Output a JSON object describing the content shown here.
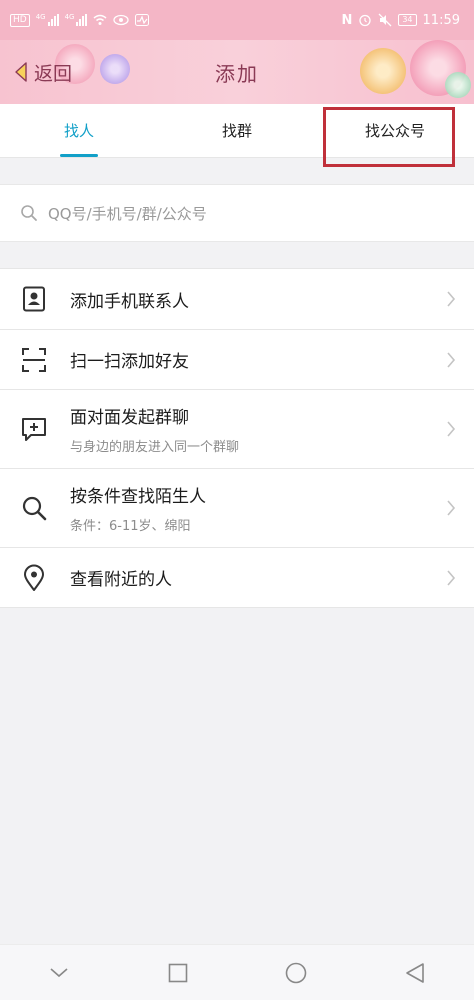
{
  "status_bar": {
    "hd_label": "HD",
    "net1": "4G",
    "net2": "4G",
    "nfc_label": "N",
    "battery": "34",
    "time": "11:59"
  },
  "header": {
    "back_label": "返回",
    "title": "添加"
  },
  "tabs": [
    {
      "label": "找人",
      "active": true
    },
    {
      "label": "找群",
      "active": false
    },
    {
      "label": "找公众号",
      "active": false
    }
  ],
  "search": {
    "placeholder": "QQ号/手机号/群/公众号"
  },
  "list": [
    {
      "icon": "contacts-icon",
      "title": "添加手机联系人",
      "subtitle": ""
    },
    {
      "icon": "scan-icon",
      "title": "扫一扫添加好友",
      "subtitle": ""
    },
    {
      "icon": "chat-add-icon",
      "title": "面对面发起群聊",
      "subtitle": "与身边的朋友进入同一个群聊"
    },
    {
      "icon": "search-icon",
      "title": "按条件查找陌生人",
      "subtitle": "条件：6-11岁、绵阳"
    },
    {
      "icon": "location-icon",
      "title": "查看附近的人",
      "subtitle": ""
    }
  ],
  "colors": {
    "accent": "#12a0c8",
    "header_bg": "#f7c3d0",
    "highlight": "#c0303a"
  },
  "nav_bar": [
    "back-chevron-icon",
    "square-icon",
    "circle-icon",
    "triangle-back-icon"
  ]
}
